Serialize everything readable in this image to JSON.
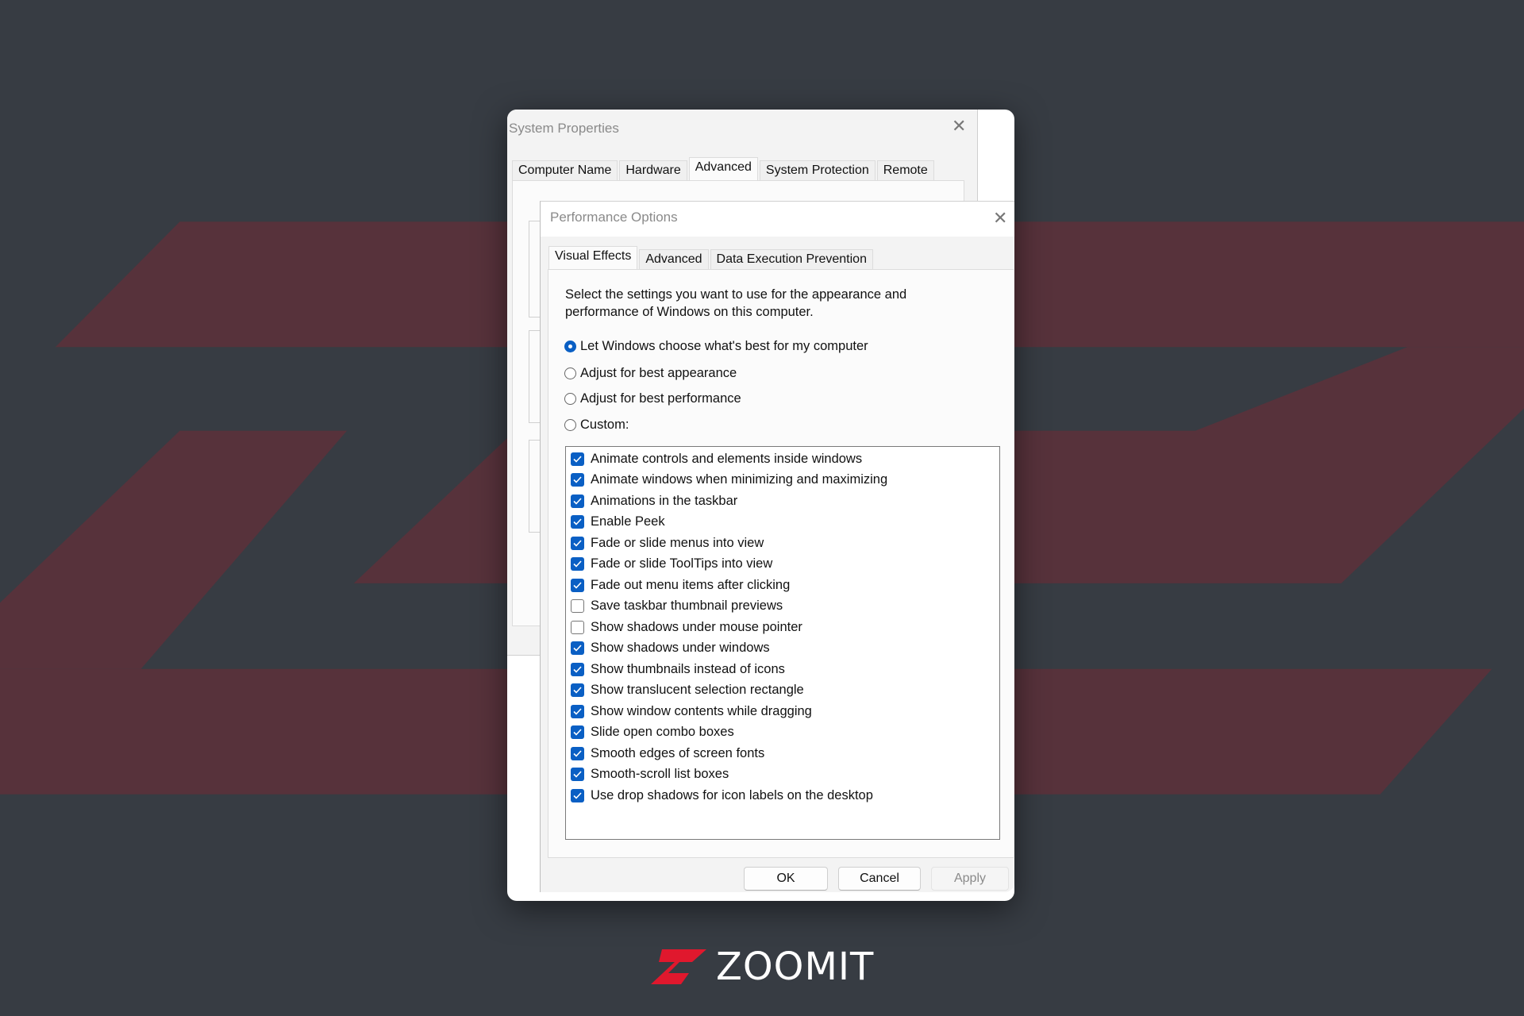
{
  "colors": {
    "background": "#373c43",
    "decor": "#57323b",
    "accent": "#0a5fc4",
    "logo_red": "#e0182d"
  },
  "system_properties": {
    "title": "System Properties",
    "close_icon": "close-icon",
    "tabs": [
      {
        "label": "Computer Name"
      },
      {
        "label": "Hardware"
      },
      {
        "label": "Advanced",
        "active": true
      },
      {
        "label": "System Protection"
      },
      {
        "label": "Remote"
      }
    ]
  },
  "performance_options": {
    "title": "Performance Options",
    "close_icon": "close-icon",
    "tabs": [
      {
        "label": "Visual Effects",
        "active": true
      },
      {
        "label": "Advanced"
      },
      {
        "label": "Data Execution Prevention"
      }
    ],
    "description": "Select the settings you want to use for the appearance and performance of Windows on this computer.",
    "radios": [
      {
        "label": "Let Windows choose what's best for my computer",
        "selected": true
      },
      {
        "label": "Adjust for best appearance",
        "selected": false
      },
      {
        "label": "Adjust for best performance",
        "selected": false
      },
      {
        "label": "Custom:",
        "selected": false
      }
    ],
    "effects": [
      {
        "label": "Animate controls and elements inside windows",
        "checked": true
      },
      {
        "label": "Animate windows when minimizing and maximizing",
        "checked": true
      },
      {
        "label": "Animations in the taskbar",
        "checked": true
      },
      {
        "label": "Enable Peek",
        "checked": true
      },
      {
        "label": "Fade or slide menus into view",
        "checked": true
      },
      {
        "label": "Fade or slide ToolTips into view",
        "checked": true
      },
      {
        "label": "Fade out menu items after clicking",
        "checked": true
      },
      {
        "label": "Save taskbar thumbnail previews",
        "checked": false
      },
      {
        "label": "Show shadows under mouse pointer",
        "checked": false
      },
      {
        "label": "Show shadows under windows",
        "checked": true
      },
      {
        "label": "Show thumbnails instead of icons",
        "checked": true
      },
      {
        "label": "Show translucent selection rectangle",
        "checked": true
      },
      {
        "label": "Show window contents while dragging",
        "checked": true
      },
      {
        "label": "Slide open combo boxes",
        "checked": true
      },
      {
        "label": "Smooth edges of screen fonts",
        "checked": true
      },
      {
        "label": "Smooth-scroll list boxes",
        "checked": true
      },
      {
        "label": "Use drop shadows for icon labels on the desktop",
        "checked": true
      }
    ],
    "buttons": {
      "ok": "OK",
      "cancel": "Cancel",
      "apply": "Apply",
      "apply_enabled": false
    }
  },
  "watermark": {
    "logo_text": "ZOOMIT"
  }
}
